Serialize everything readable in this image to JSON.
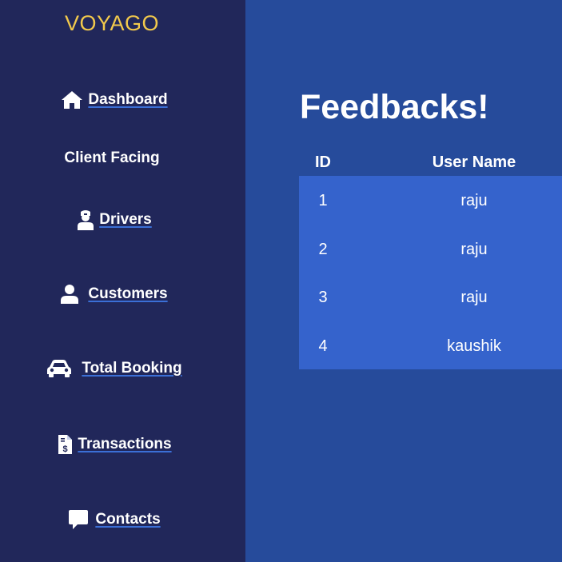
{
  "brand": "VOYAGO",
  "sidebar": {
    "dashboard": {
      "label": "Dashboard",
      "icon": "home-icon"
    },
    "section_title": "Client Facing",
    "items": [
      {
        "label": "Drivers",
        "icon": "driver-icon"
      },
      {
        "label": "Customers",
        "icon": "user-icon"
      },
      {
        "label": "Total Booking",
        "icon": "car-icon"
      },
      {
        "label": "Transactions",
        "icon": "receipt-dollar-icon"
      },
      {
        "label": "Contacts",
        "icon": "comment-icon"
      }
    ]
  },
  "main": {
    "title": "Feedbacks!",
    "table": {
      "headers": {
        "id": "ID",
        "user": "User Name"
      },
      "rows": [
        {
          "id": "1",
          "user": "raju"
        },
        {
          "id": "2",
          "user": "raju"
        },
        {
          "id": "3",
          "user": "raju"
        },
        {
          "id": "4",
          "user": "kaushik"
        }
      ]
    }
  },
  "colors": {
    "sidebar_bg": "#21275a",
    "main_bg": "#264b9b",
    "table_body_bg": "#3563cc",
    "brand": "#f2c94c"
  }
}
